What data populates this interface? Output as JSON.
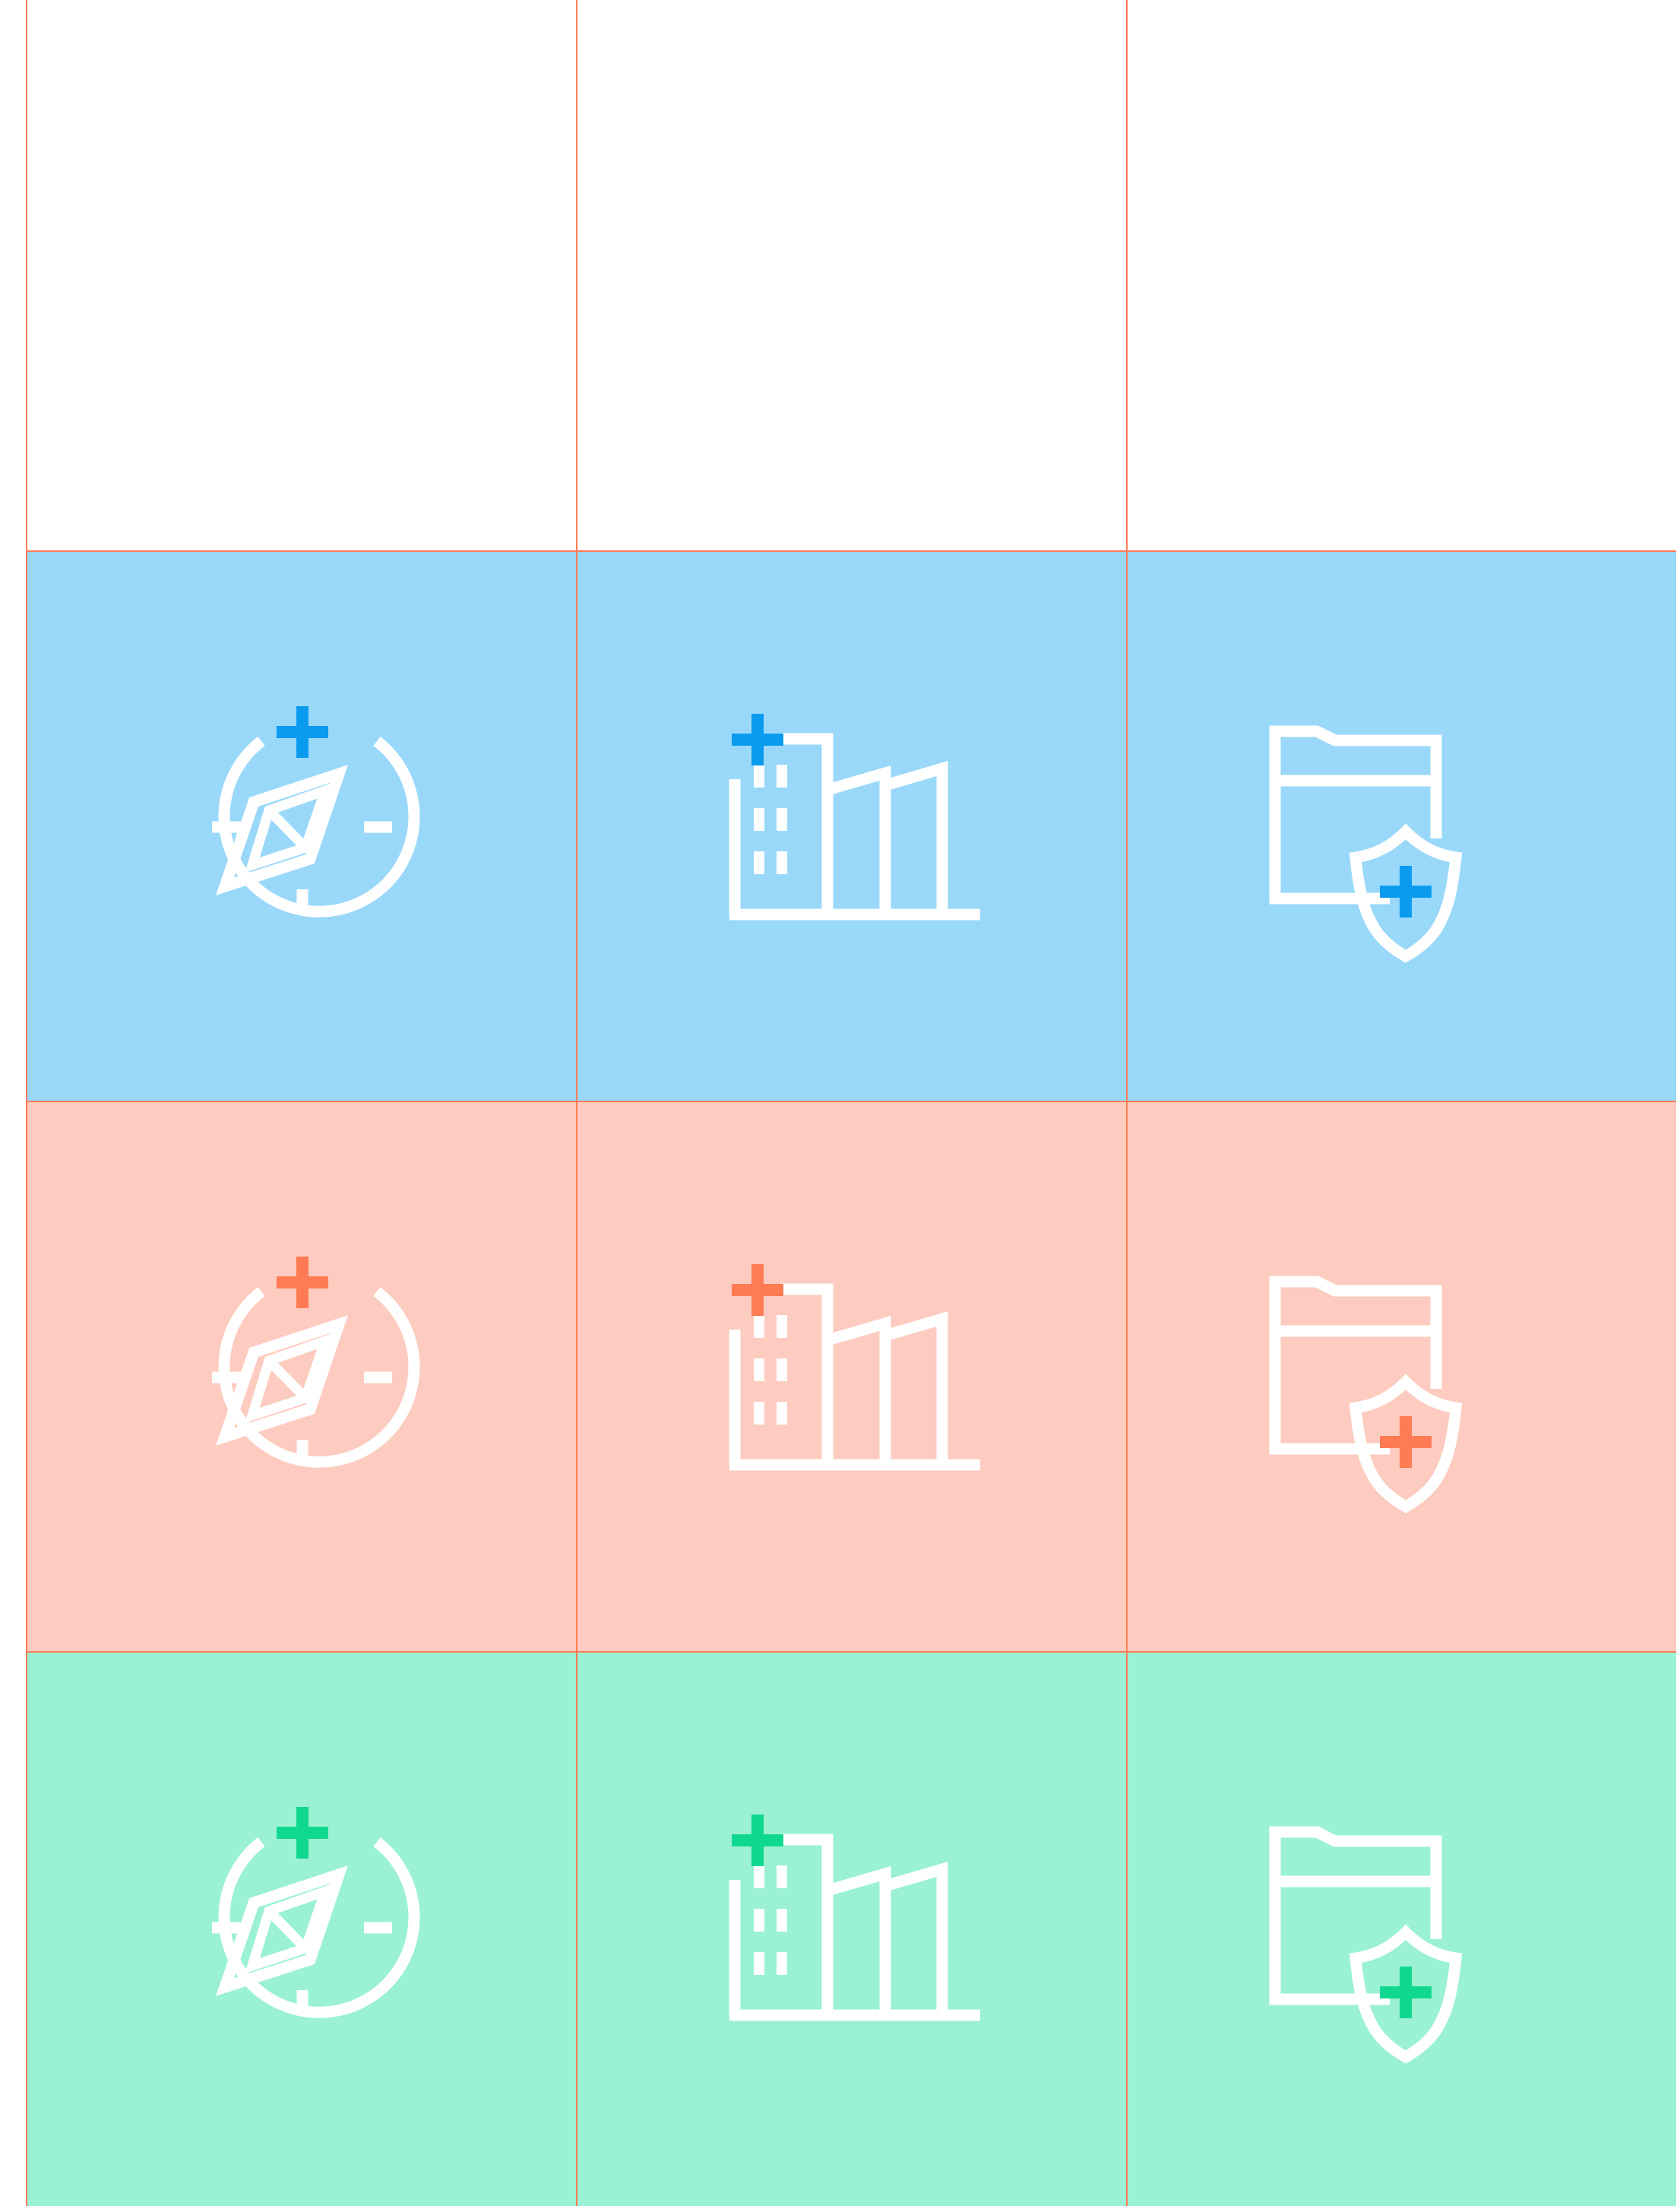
{
  "icons": [
    "compass-plus-icon",
    "buildings-plus-icon",
    "folder-shield-plus-icon"
  ],
  "rows": [
    {
      "name": "empty",
      "background": "#ffffff",
      "accent": null
    },
    {
      "name": "blue",
      "background": "#9ad8fa",
      "accent": "#0a9bef"
    },
    {
      "name": "salmon",
      "background": "#fdcbbf",
      "accent": "#ff7b54"
    },
    {
      "name": "green",
      "background": "#9af1d4",
      "accent": "#10d98f"
    }
  ],
  "grid_line_color": "#ff7b54"
}
